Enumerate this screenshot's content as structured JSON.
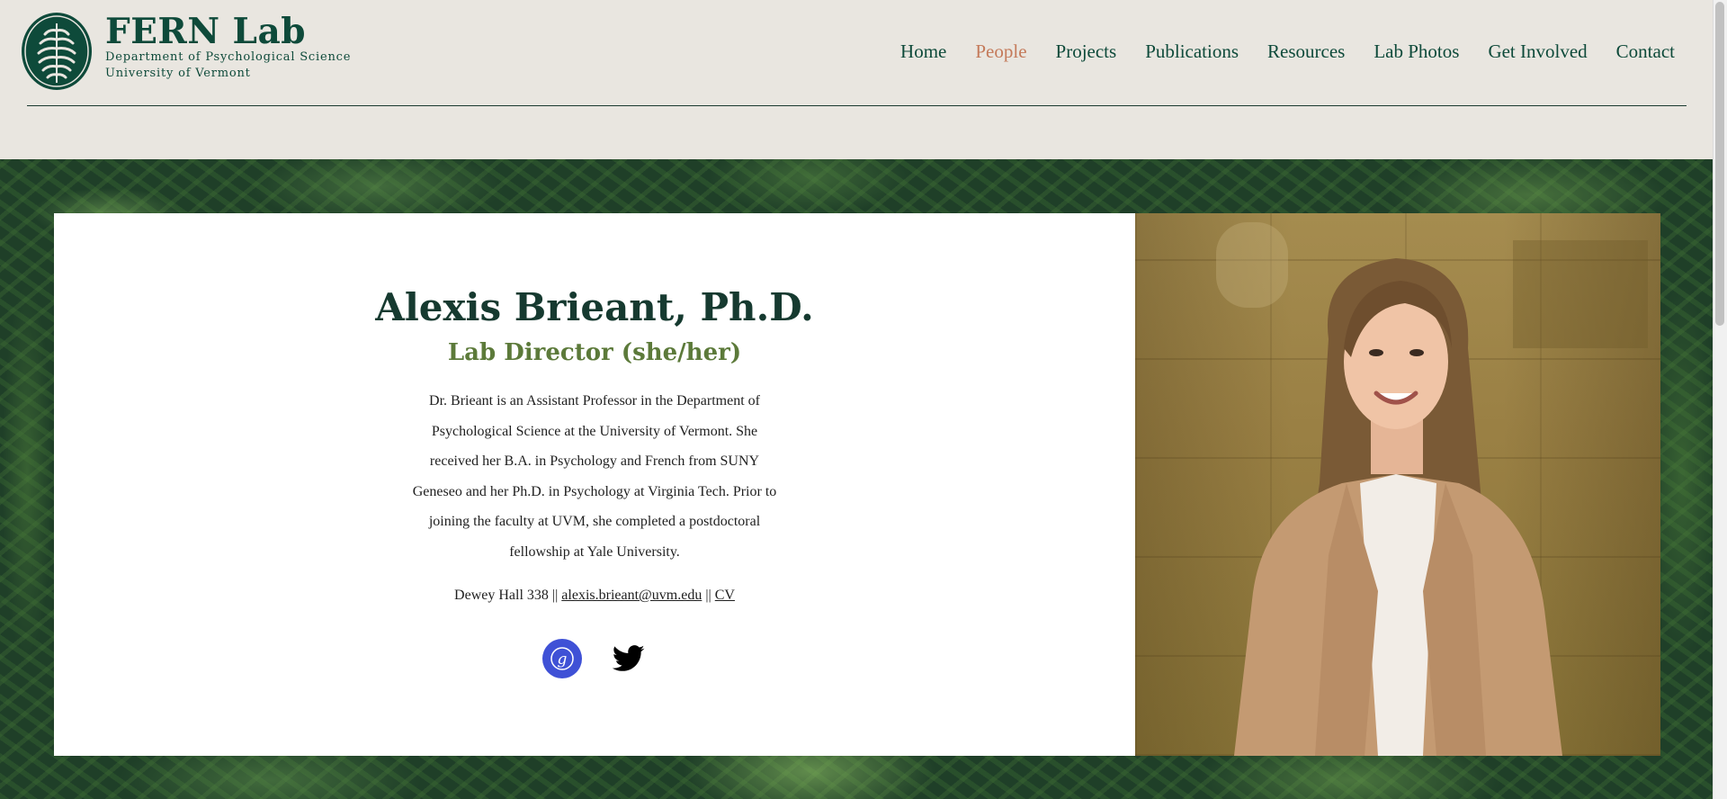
{
  "brand": {
    "title": "FERN Lab",
    "subtitle_line1": "Department of Psychological Science",
    "subtitle_line2": "University of Vermont",
    "logo_icon": "fern-leaf-icon",
    "color": "#0e4a3a"
  },
  "nav": {
    "items": [
      {
        "label": "Home"
      },
      {
        "label": "People",
        "active": true
      },
      {
        "label": "Projects"
      },
      {
        "label": "Publications"
      },
      {
        "label": "Resources"
      },
      {
        "label": "Lab Photos"
      },
      {
        "label": "Get Involved"
      },
      {
        "label": "Contact"
      }
    ],
    "active_color": "#c47a5a"
  },
  "profile": {
    "name": "Alexis Brieant, Ph.D.",
    "role": "Lab Director (she/her)",
    "bio": "Dr. Brieant is an Assistant Professor in the Department of Psychological Science at the University of Vermont. She received her B.A. in Psychology and French from SUNY Geneseo and her Ph.D. in Psychology at Virginia Tech. Prior to joining the faculty at UVM, she completed a postdoctoral fellowship at Yale University.",
    "office": "Dewey Hall 338",
    "separator": "||",
    "email": "alexis.brieant@uvm.edu",
    "cv_label": "CV",
    "socials": [
      {
        "name": "google-scholar-icon",
        "color": "#3f51d6"
      },
      {
        "name": "twitter-icon",
        "color": "#000000"
      }
    ]
  }
}
